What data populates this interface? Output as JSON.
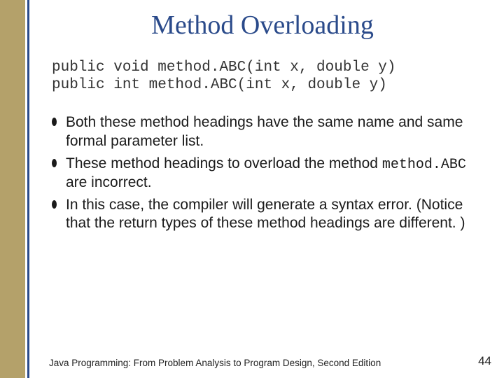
{
  "title": "Method Overloading",
  "code": {
    "line1": "public void method.ABC(int x, double y)",
    "line2": "public int method.ABC(int x, double y)"
  },
  "bullets": {
    "b1": "Both these method headings have the same name and same formal parameter list.",
    "b2a": "These method headings to overload the method ",
    "b2b": "method.ABC",
    "b2c": " are incorrect.",
    "b3": "In this case, the compiler will generate a syntax error. (Notice that the return types of these method headings are different. )"
  },
  "footer": "Java Programming: From Problem Analysis to Program Design, Second Edition",
  "page": "44"
}
